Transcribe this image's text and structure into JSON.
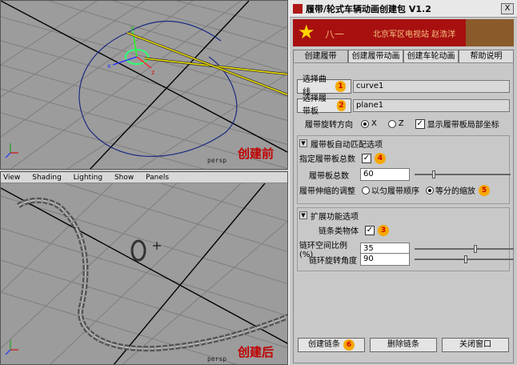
{
  "window": {
    "title": "履带/轮式车辆动画创建包 V1.2",
    "close_label": "X"
  },
  "banner": {
    "left_text": "八一",
    "right_text": "北京军区电视站 赵浩洋"
  },
  "tabs": [
    {
      "label": "创建履带"
    },
    {
      "label": "创建履带动画"
    },
    {
      "label": "创建车轮动画"
    },
    {
      "label": "帮助说明"
    }
  ],
  "create_track": {
    "select_curve_button": "选择曲线",
    "curve_value": "curve1",
    "select_plank_button": "选择履带板",
    "plank_value": "plane1",
    "badge1": "1",
    "badge2": "2",
    "rotation_label": "履带旋转方向",
    "radio_x": "X",
    "radio_z": "Z",
    "show_pivot_label": "显示履带板局部坐标",
    "show_pivot_checked": "✓"
  },
  "auto_fit": {
    "header": "履带板自动匹配选项",
    "specify_count_label": "指定履带板总数",
    "specify_count_checked": "✓",
    "badge4": "4",
    "total_label": "履带板总数",
    "total_value": "60",
    "total_slider": 0.18,
    "fit_mode_label": "履带伸缩的调整",
    "fit_mode_option1": "以匀履带顺序",
    "fit_mode_option2": "等分的缩放",
    "badge5": "5"
  },
  "extra": {
    "header": "扩展功能选项",
    "chain_label": "链条类物体",
    "chain_checked": "✓",
    "badge3": "3",
    "ratio_label": "链环空间比例(%)",
    "ratio_value": "35",
    "ratio_slider": 0.6,
    "angle_label": "链环旋转角度",
    "angle_value": "90",
    "angle_slider": 0.5
  },
  "footer": {
    "create_button": "创建链条",
    "badge6": "6",
    "delete_button": "删除链条",
    "close_button": "关闭窗口"
  },
  "viewport_top": {
    "label": "创建前",
    "camera": "persp"
  },
  "viewport_bottom": {
    "menu": [
      "View",
      "Shading",
      "Lighting",
      "Show",
      "Panels"
    ],
    "label": "创建后",
    "camera": "persp"
  },
  "colors": {
    "accent_red": "#c00000",
    "badge_orange": "#f5a800",
    "arrow_yellow": "#f0e000",
    "banner_red": "#a81010"
  }
}
